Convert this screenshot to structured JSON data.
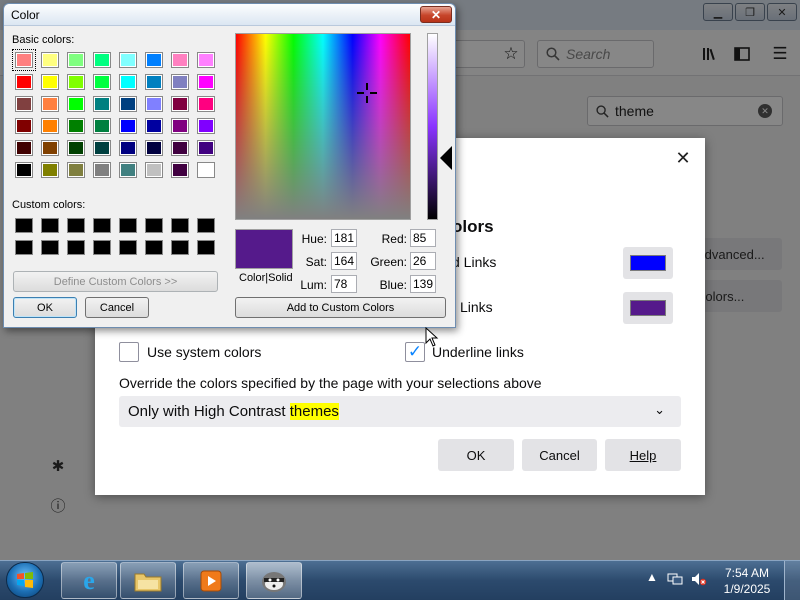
{
  "firefox": {
    "search": {
      "placeholder": "Search"
    },
    "find_in_prefs": {
      "value": "theme"
    },
    "bg_buttons": [
      "Advanced...",
      "Colors..."
    ],
    "side_icons": [
      "puzzle-icon",
      "help-icon"
    ]
  },
  "colors_dialog": {
    "heading": "olors",
    "rows": [
      {
        "label": "d Links",
        "color": "#0000ff"
      },
      {
        "label": "Links",
        "color": "#551a8b"
      }
    ],
    "use_system_colors": {
      "label": "Use system colors",
      "checked": false
    },
    "underline_links": {
      "label": "Underline links",
      "checked": true
    },
    "override_label": "Override the colors specified by the page with your selections above",
    "select": {
      "prefix": "Only with High Contrast ",
      "highlight": "themes"
    },
    "buttons": {
      "ok": "OK",
      "cancel": "Cancel",
      "help": "Help"
    }
  },
  "color_picker": {
    "title": "Color",
    "basic_label": "Basic colors:",
    "custom_label": "Custom colors:",
    "basic_colors": [
      "#ff8080",
      "#ffff80",
      "#80ff80",
      "#00ff80",
      "#80ffff",
      "#0080ff",
      "#ff80c0",
      "#ff80ff",
      "#ff0000",
      "#ffff00",
      "#80ff00",
      "#00ff40",
      "#00ffff",
      "#0080c0",
      "#8080c0",
      "#ff00ff",
      "#804040",
      "#ff8040",
      "#00ff00",
      "#008080",
      "#004080",
      "#8080ff",
      "#800040",
      "#ff0080",
      "#800000",
      "#ff8000",
      "#008000",
      "#008040",
      "#0000ff",
      "#0000a0",
      "#800080",
      "#8000ff",
      "#400000",
      "#804000",
      "#004000",
      "#004040",
      "#000080",
      "#000040",
      "#400040",
      "#400080",
      "#000000",
      "#808000",
      "#808040",
      "#808080",
      "#408080",
      "#c0c0c0",
      "#400040",
      "#ffffff"
    ],
    "selected_index": 0,
    "custom_colors_count": 16,
    "define_custom": "Define Custom Colors >>",
    "ok": "OK",
    "cancel": "Cancel",
    "preview_label": "Color|Solid",
    "preview_color": "#551a8b",
    "hue_label": "Hue:",
    "hue": "181",
    "sat_label": "Sat:",
    "sat": "164",
    "lum_label": "Lum:",
    "lum": "78",
    "red_label": "Red:",
    "red": "85",
    "green_label": "Green:",
    "green": "26",
    "blue_label": "Blue:",
    "blue": "139",
    "add_custom": "Add to Custom Colors"
  },
  "taskbar": {
    "time": "7:54 AM",
    "date": "1/9/2025",
    "apps": [
      "internet-explorer",
      "file-explorer",
      "media-player",
      "raccoon-app"
    ]
  }
}
